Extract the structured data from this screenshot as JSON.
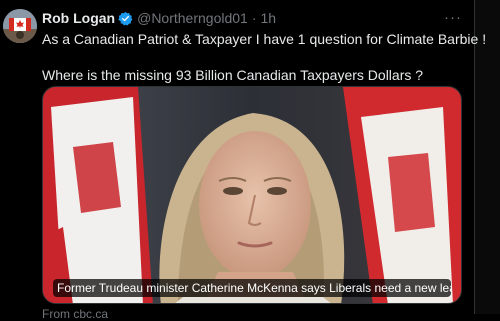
{
  "post": {
    "display_name": "Rob Logan",
    "handle": "@Northerngold01",
    "separator": "·",
    "time": "1h",
    "verified_icon": "verified-badge-icon",
    "more_icon": "more-horizontal-icon",
    "text_line_1": "As a Canadian Patriot & Taxpayer I have 1 question for  Climate Barbie !",
    "text_line_2": "Where is the missing 93 Billion Canadian Taxpayers Dollars ?",
    "more_label": "···"
  },
  "media": {
    "caption": "Former Trudeau minister Catherine McKenna says Liberals need a new leader | C..."
  },
  "below": {
    "text": "From cbc.ca"
  },
  "colors": {
    "background": "#000000",
    "text": "#e7e9ea",
    "muted": "#71767b",
    "verified": "#1d9bf0",
    "border": "#2f3336"
  }
}
